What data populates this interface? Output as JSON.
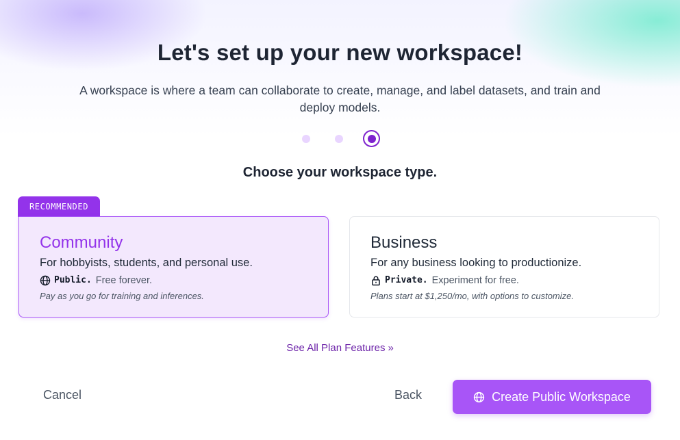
{
  "header": {
    "title": "Let's set up your new workspace!",
    "subtitle": "A workspace is where a team can collaborate to create, manage, and label datasets, and train and deploy models."
  },
  "stepper": {
    "total_steps": 3,
    "current_step": 3
  },
  "section_heading": "Choose your workspace type.",
  "cards": {
    "community": {
      "tag": "RECOMMENDED",
      "title": "Community",
      "description": "For hobbyists, students, and personal use.",
      "visibility_icon": "globe-icon",
      "visibility_label": "Public.",
      "visibility_text": "Free forever.",
      "note": "Pay as you go for training and inferences.",
      "selected": true
    },
    "business": {
      "title": "Business",
      "description": "For any business looking to productionize.",
      "visibility_icon": "lock-icon",
      "visibility_label": "Private.",
      "visibility_text": "Experiment for free.",
      "note": "Plans start at $1,250/mo, with options to customize.",
      "selected": false
    }
  },
  "see_all_link": {
    "label": "See All Plan Features",
    "icon": "double-chevron-right-icon"
  },
  "footer": {
    "cancel_label": "Cancel",
    "back_label": "Back",
    "create_label": "Create Public Workspace",
    "create_icon": "globe-icon"
  },
  "colors": {
    "accent": "#9333ea",
    "accent_button": "#a855f7",
    "selected_card_bg": "#f3e8fd",
    "link": "#6b21a8"
  }
}
